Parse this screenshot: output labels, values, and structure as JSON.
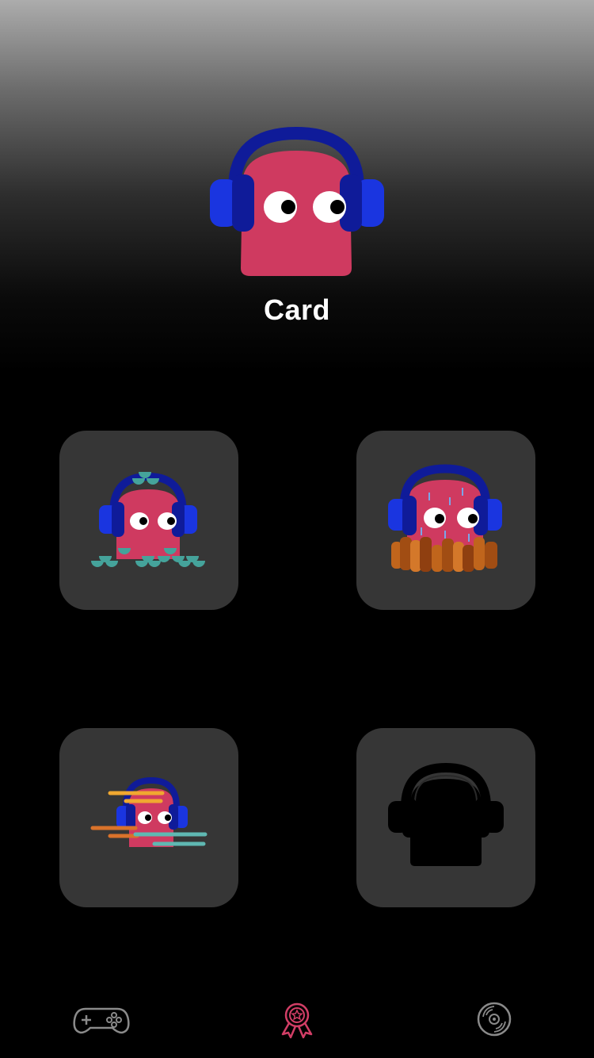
{
  "header": {
    "title": "Card"
  },
  "colors": {
    "monster": "#cf3a60",
    "headphone_dark": "#0f1b99",
    "headphone_light": "#1a35e0",
    "card_bg": "#363636",
    "nav_inactive": "#8a8a8a",
    "nav_active": "#d23e66",
    "locked_silhouette": "#000000"
  },
  "cards": [
    {
      "theme": "waves",
      "locked": false
    },
    {
      "theme": "fire-rain",
      "locked": false
    },
    {
      "theme": "speed",
      "locked": false
    },
    {
      "theme": "locked",
      "locked": true
    }
  ],
  "nav": {
    "items": [
      {
        "icon": "gamepad-icon",
        "active": false
      },
      {
        "icon": "award-icon",
        "active": true
      },
      {
        "icon": "vinyl-disc-icon",
        "active": false
      }
    ]
  }
}
